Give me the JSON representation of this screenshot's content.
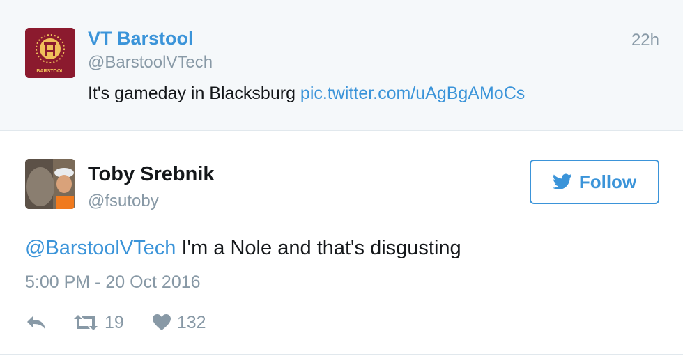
{
  "parent_tweet": {
    "name": "VT Barstool",
    "handle": "@BarstoolVTech",
    "time": "22h",
    "text": "It's gameday in Blacksburg ",
    "link": "pic.twitter.com/uAgBgAMoCs",
    "avatar_text": "BARSTOOL",
    "avatar_icon": "barstool-logo-icon"
  },
  "tweet": {
    "name": "Toby Srebnik",
    "handle": "@fsutoby",
    "follow_label": "Follow",
    "mention": "@BarstoolVTech",
    "text": " I'm a Nole and that's disgusting",
    "date": "5:00 PM - 20 Oct 2016",
    "retweet_count": "19",
    "like_count": "132"
  },
  "icons": {
    "reply": "reply-icon",
    "retweet": "retweet-icon",
    "like": "heart-icon",
    "bird": "twitter-bird-icon"
  },
  "colors": {
    "accent": "#3b94d9",
    "muted": "#8899a6",
    "text": "#14171a",
    "parent_bg": "#f5f8fa",
    "barstool_maroon": "#8b1a2e"
  }
}
